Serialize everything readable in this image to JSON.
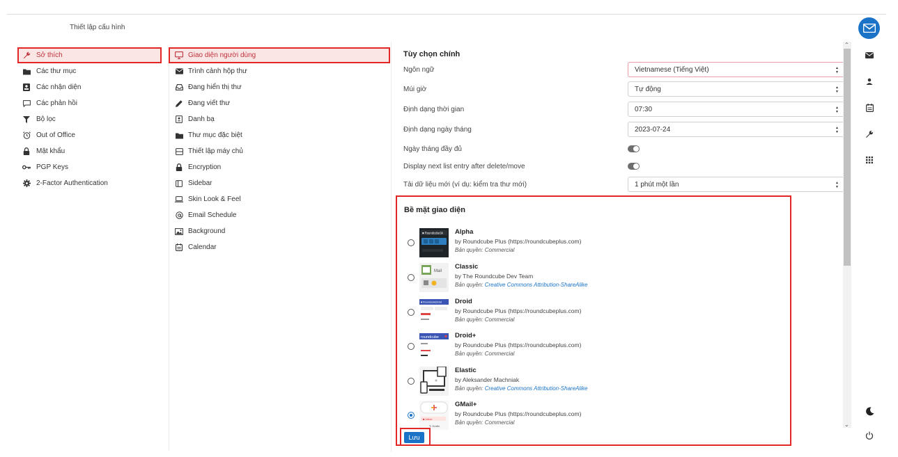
{
  "header": {
    "title": "Thiết lập cấu hình"
  },
  "sections": [
    {
      "label": "Sở thích",
      "icon": "wrench-icon",
      "active": true
    },
    {
      "label": "Các thư mục",
      "icon": "folder-icon"
    },
    {
      "label": "Các nhận diện",
      "icon": "id-card-icon"
    },
    {
      "label": "Các phản hồi",
      "icon": "comment-icon"
    },
    {
      "label": "Bộ lọc",
      "icon": "filter-icon"
    },
    {
      "label": "Out of Office",
      "icon": "alarm-clock-icon"
    },
    {
      "label": "Mật khẩu",
      "icon": "lock-icon"
    },
    {
      "label": "PGP Keys",
      "icon": "key-icon"
    },
    {
      "label": "2-Factor Authentication",
      "icon": "gear-icon"
    }
  ],
  "subsections": [
    {
      "label": "Giao diện người dùng",
      "icon": "monitor-icon",
      "active": true
    },
    {
      "label": "Trình cảnh hộp thư",
      "icon": "envelope-icon"
    },
    {
      "label": "Đang hiển thị thư",
      "icon": "inbox-icon"
    },
    {
      "label": "Đang viết thư",
      "icon": "pencil-icon"
    },
    {
      "label": "Danh bạ",
      "icon": "address-book-icon"
    },
    {
      "label": "Thư mục đặc biệt",
      "icon": "folder-icon"
    },
    {
      "label": "Thiết lập máy chủ",
      "icon": "server-icon"
    },
    {
      "label": "Encryption",
      "icon": "lock-icon"
    },
    {
      "label": "Sidebar",
      "icon": "sidebar-icon"
    },
    {
      "label": "Skin Look & Feel",
      "icon": "laptop-icon"
    },
    {
      "label": "Email Schedule",
      "icon": "at-sign-icon"
    },
    {
      "label": "Background",
      "icon": "image-icon"
    },
    {
      "label": "Calendar",
      "icon": "calendar-icon"
    }
  ],
  "main": {
    "main_title": "Tùy chọn chính",
    "options": [
      {
        "label": "Ngôn ngữ",
        "type": "select",
        "value": "Vietnamese (Tiếng Việt)",
        "focused": true
      },
      {
        "label": "Múi giờ",
        "type": "select",
        "value": "Tự động"
      },
      {
        "label": "Định dạng thời gian",
        "type": "select",
        "value": "07:30"
      },
      {
        "label": "Định dạng ngày tháng",
        "type": "select",
        "value": "2023-07-24"
      },
      {
        "label": "Ngày tháng đầy đủ",
        "type": "toggle",
        "value": "on"
      },
      {
        "label": "Display next list entry after delete/move",
        "type": "toggle",
        "value": "on"
      },
      {
        "label": "Tải dữ liệu mới (ví dụ: kiểm tra thư mới)",
        "type": "select",
        "value": "1 phút một lần"
      }
    ],
    "skin_title": "Bề mặt giao diện",
    "license_prefix": "Bản quyền:",
    "skins": [
      {
        "name": "Alpha",
        "author": "by Roundcube Plus (https://roundcubeplus.com)",
        "license": "Commercial",
        "license_link": false,
        "selected": false,
        "thumb_text": "RoundcubeSk"
      },
      {
        "name": "Classic",
        "author": "by The Roundcube Dev Team",
        "license": "Creative Commons Attribution-ShareAlike",
        "license_link": true,
        "selected": false,
        "thumb_text": "Mail"
      },
      {
        "name": "Droid",
        "author": "by Roundcube Plus (https://roundcubeplus.com)",
        "license": "Commercial",
        "license_link": false,
        "selected": false,
        "thumb_text": "RoundcubeDroid"
      },
      {
        "name": "Droid+",
        "author": "by Roundcube Plus (https://roundcubeplus.com)",
        "license": "Commercial",
        "license_link": false,
        "selected": false,
        "thumb_text": "roundcube"
      },
      {
        "name": "Elastic",
        "author": "by Aleksander Machniak",
        "license": "Creative Commons Attribution-ShareAlike",
        "license_link": true,
        "selected": false,
        "thumb_text": ""
      },
      {
        "name": "GMail+",
        "author": "by Roundcube Plus (https://roundcubeplus.com)",
        "license": "Commercial",
        "license_link": false,
        "selected": true,
        "thumb_text": "Inbox"
      }
    ],
    "save_label": "Lưu"
  },
  "rail": {
    "logo": "envelope-logo-icon",
    "items": [
      "mail-icon",
      "contacts-icon",
      "calendar-icon",
      "settings-wrench-icon",
      "apps-grid-icon"
    ],
    "bottom": [
      "dark-mode-moon-icon",
      "logout-power-icon"
    ]
  },
  "colors": {
    "accent": "#1a73c7",
    "active_bg": "#fbe6e6",
    "active_border": "#e32626",
    "active_text": "#c0313a"
  }
}
